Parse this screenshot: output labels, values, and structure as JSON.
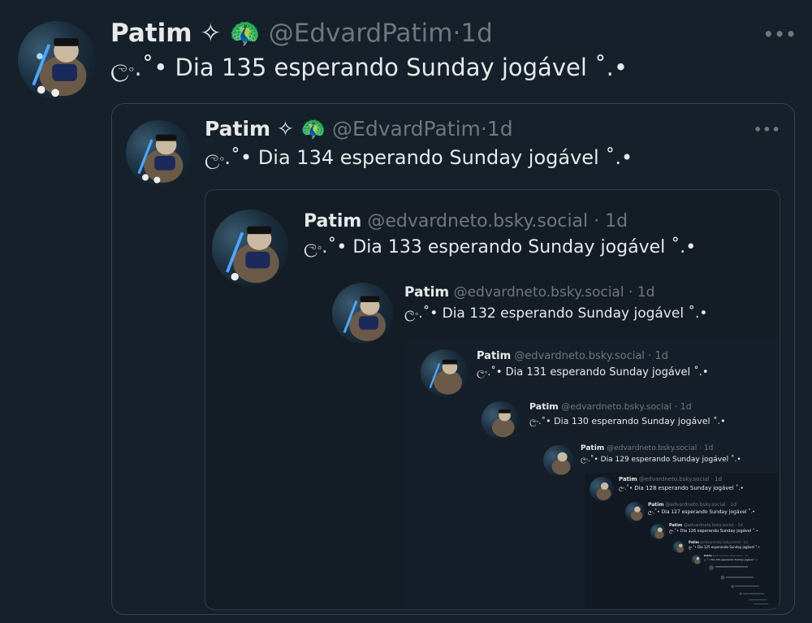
{
  "posts": [
    {
      "name": "Patim",
      "sparkle": "✧",
      "emoji": "🦚",
      "handle": "@EdvardPatim",
      "sep": "·",
      "time": "1d",
      "text": "ලං.˚• Dia 135 esperando Sunday jogável ˚.•",
      "more": "•••"
    },
    {
      "name": "Patim",
      "sparkle": "✧",
      "emoji": "🦚",
      "handle": "@EdvardPatim",
      "sep": "·",
      "time": "1d",
      "text": "ලං.˚• Dia 134 esperando Sunday jogável ˚.•",
      "more": "•••"
    },
    {
      "name": "Patim",
      "handle": "@edvardneto.bsky.social",
      "sep": "·",
      "time": "1d",
      "text": "ලං.˚• Dia 133 esperando Sunday jogável ˚.•"
    },
    {
      "name": "Patim",
      "handle": "@edvardneto.bsky.social",
      "sep": "·",
      "time": "1d",
      "text": "ලං.˚• Dia 132 esperando Sunday jogável ˚.•"
    },
    {
      "name": "Patim",
      "handle": "@edvardneto.bsky.social",
      "sep": "·",
      "time": "1d",
      "text": "ලං.˚• Dia 131 esperando Sunday jogável ˚.•"
    },
    {
      "name": "Patim",
      "handle": "@edvardneto.bsky.social",
      "sep": "·",
      "time": "1d",
      "text": "ලං.˚• Dia 130 esperando Sunday jogável ˚.•"
    },
    {
      "name": "Patim",
      "handle": "@edvardneto.bsky.social",
      "sep": "·",
      "time": "1d",
      "text": "ලං.˚• Dia 129 esperando Sunday jogável ˚.•"
    },
    {
      "name": "Patim",
      "handle": "@edvardneto.bsky.social",
      "sep": "·",
      "time": "1d",
      "text": "ලං.˚• Dia 128 esperando Sunday jogável ˚.•"
    },
    {
      "name": "Patim",
      "handle": "@edvardneto.bsky.social",
      "sep": "·",
      "time": "1d",
      "text": "ලං.˚• Dia 127 esperando Sunday jogável ˚.•"
    },
    {
      "name": "Patim",
      "handle": "@edvardneto.bsky.social",
      "sep": "·",
      "time": "1d",
      "text": "ලං.˚• Dia 126 esperando Sunday jogável ˚.•"
    },
    {
      "name": "Patim",
      "handle": "@edvardneto.bsky.social",
      "sep": "·",
      "time": "1d",
      "text": "ලං.˚• Dia 125 esperando Sunday jogável ˚.•"
    },
    {
      "name": "Patim",
      "handle": "@edvardneto.bsky.social",
      "sep": "·",
      "time": "1d",
      "text": "ලං.˚• Dia 124 esperando Sunday jogável ˚.•"
    }
  ],
  "colors": {
    "background": "#15202b",
    "muted": "#71767b",
    "text": "#e7e9ea",
    "border": "#38444d"
  }
}
